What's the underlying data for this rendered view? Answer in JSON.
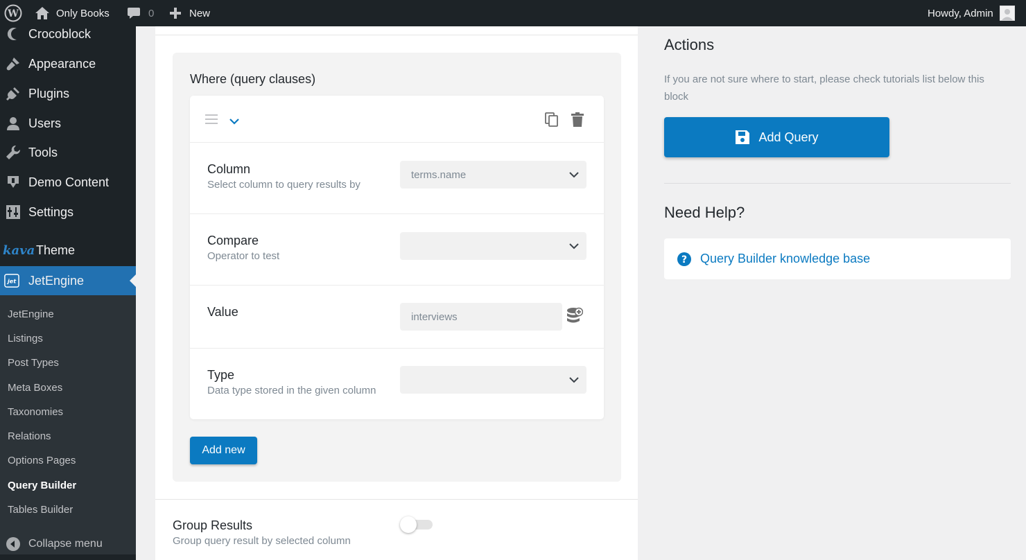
{
  "adminbar": {
    "site_name": "Only Books",
    "comments_count": "0",
    "new_label": "New",
    "greeting": "Howdy, Admin"
  },
  "sidebar": {
    "items": [
      {
        "label": "Crocoblock",
        "icon": "crocoblock-icon"
      },
      {
        "label": "Appearance",
        "icon": "paintbrush-icon"
      },
      {
        "label": "Plugins",
        "icon": "plugin-icon"
      },
      {
        "label": "Users",
        "icon": "user-icon"
      },
      {
        "label": "Tools",
        "icon": "wrench-icon"
      },
      {
        "label": "Demo Content",
        "icon": "download-icon"
      },
      {
        "label": "Settings",
        "icon": "settings-icon"
      },
      {
        "label": "Theme",
        "brand": "kava",
        "icon": "kava-logo"
      },
      {
        "label": "JetEngine",
        "icon": "jetengine-icon"
      }
    ],
    "submenu": [
      "JetEngine",
      "Listings",
      "Post Types",
      "Meta Boxes",
      "Taxonomies",
      "Relations",
      "Options Pages",
      "Query Builder",
      "Tables Builder"
    ],
    "current_submenu": "Query Builder",
    "collapse_label": "Collapse menu"
  },
  "main": {
    "where_title": "Where (query clauses)",
    "rows": {
      "column": {
        "label": "Column",
        "desc": "Select column to query results by",
        "value": "terms.name"
      },
      "compare": {
        "label": "Compare",
        "desc": "Operator to test",
        "value": ""
      },
      "value": {
        "label": "Value",
        "value": "interviews"
      },
      "type": {
        "label": "Type",
        "desc": "Data type stored in the given column",
        "value": ""
      }
    },
    "add_new_label": "Add new",
    "group_results": {
      "label": "Group Results",
      "desc": "Group query result by selected column",
      "enabled": false
    }
  },
  "actions": {
    "title": "Actions",
    "note": "If you are not sure where to start, please check tutorials list below this block",
    "add_query_label": "Add Query"
  },
  "help": {
    "title": "Need Help?",
    "link_label": "Query Builder knowledge base"
  },
  "colors": {
    "admin_bg": "#1d2327",
    "accent": "#0b7ac1",
    "menu_active": "#2271b1"
  }
}
